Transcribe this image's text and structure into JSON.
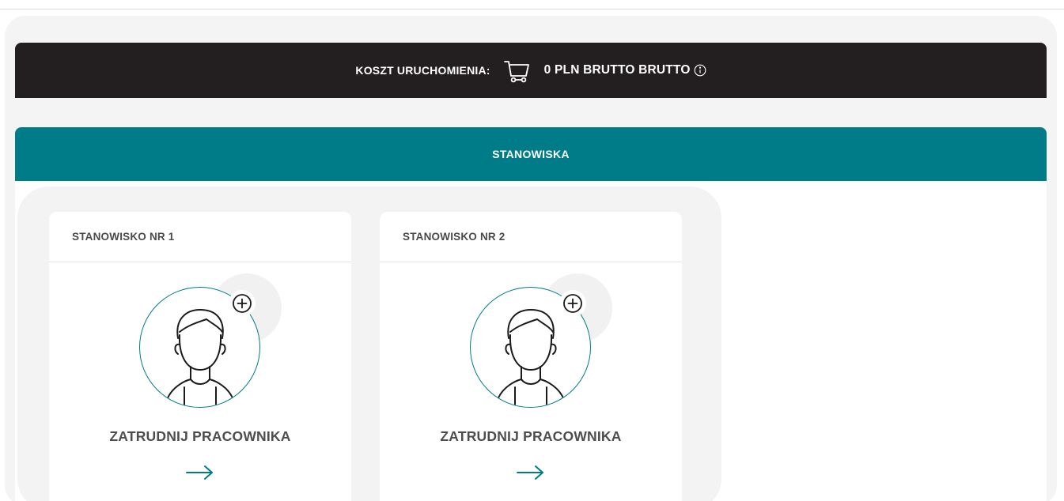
{
  "cost_bar": {
    "label": "KOSZT URUCHOMIENIA:",
    "cart_icon": "shopping-cart-icon",
    "value": "0 PLN BRUTTO BRUTTO",
    "info_icon": "info-icon"
  },
  "section": {
    "title": "STANOWISKA"
  },
  "cards": [
    {
      "title": "STANOWISKO NR 1",
      "avatar_icon": "person-avatar-icon",
      "add_icon": "plus-circle-icon",
      "action_label": "ZATRUDNIJ PRACOWNIKA",
      "arrow_icon": "arrow-right-icon"
    },
    {
      "title": "STANOWISKO NR 2",
      "avatar_icon": "person-avatar-icon",
      "add_icon": "plus-circle-icon",
      "action_label": "ZATRUDNIJ PRACOWNIKA",
      "arrow_icon": "arrow-right-icon"
    }
  ],
  "colors": {
    "dark_bar": "#231f20",
    "teal": "#007c89",
    "text_grey": "#4d4d4d",
    "background": "#ffffff"
  }
}
